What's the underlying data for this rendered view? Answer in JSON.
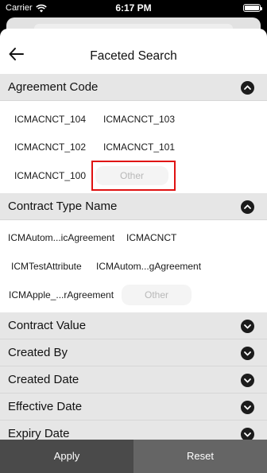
{
  "status_bar": {
    "carrier": "Carrier",
    "time": "6:17 PM"
  },
  "header": {
    "title": "Faceted Search"
  },
  "sections": {
    "agreement_code": {
      "label": "Agreement Code",
      "options": [
        "ICMACNCT_104",
        "ICMACNCT_103",
        "ICMACNCT_102",
        "ICMACNCT_101",
        "ICMACNCT_100"
      ],
      "other_label": "Other"
    },
    "contract_type_name": {
      "label": "Contract Type Name",
      "options": [
        "ICMAutom...icAgreement",
        "ICMACNCT",
        "ICMTestAttribute",
        "ICMAutom...gAgreement",
        "ICMApple_...rAgreement"
      ],
      "other_label": "Other"
    },
    "contract_value": {
      "label": "Contract Value"
    },
    "created_by": {
      "label": "Created By"
    },
    "created_date": {
      "label": "Created Date"
    },
    "effective_date": {
      "label": "Effective Date"
    },
    "expiry_date": {
      "label": "Expiry Date"
    }
  },
  "footer": {
    "apply_label": "Apply",
    "reset_label": "Reset"
  },
  "colors": {
    "highlight": "#e01212",
    "section_header_bg": "#e6e6e6",
    "apply_bg": "#4a4a4a",
    "reset_bg": "#656565"
  },
  "icons": {
    "back": "arrow-left-icon",
    "expanded": "chevron-up-icon",
    "collapsed": "chevron-down-icon",
    "wifi": "wifi-icon",
    "battery": "battery-icon"
  }
}
